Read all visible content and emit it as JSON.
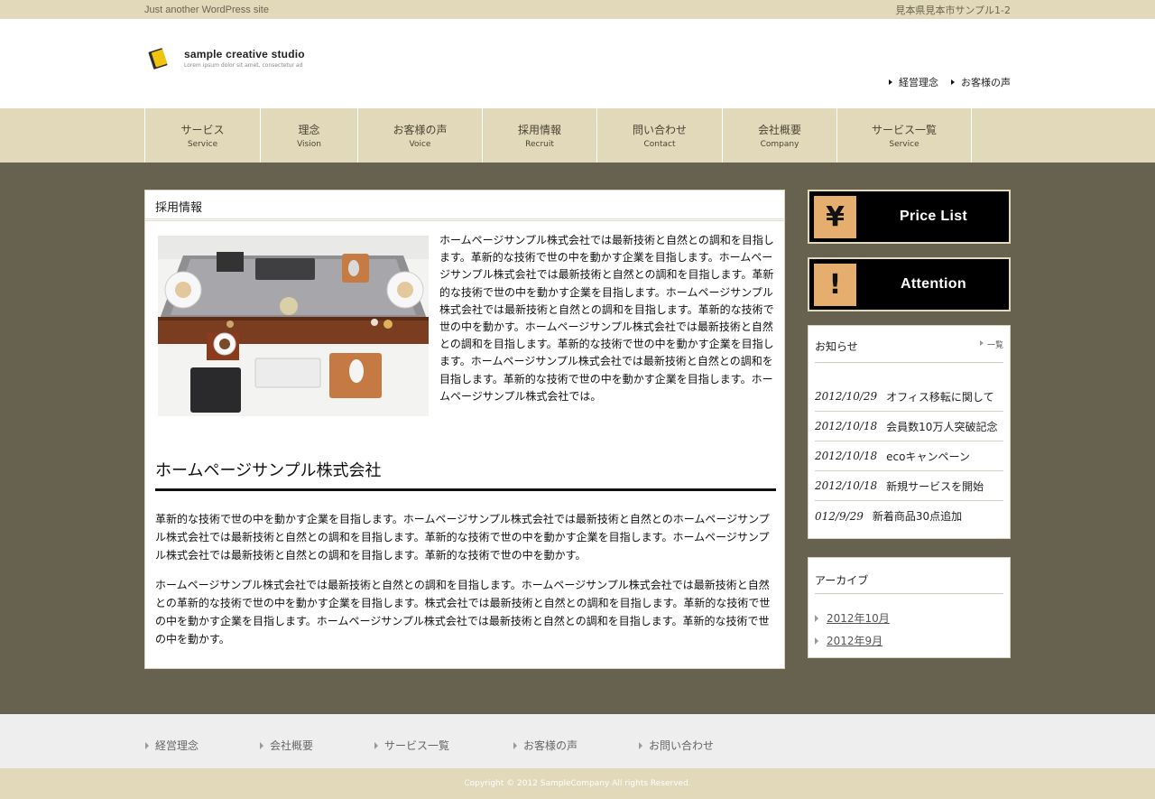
{
  "topbar": {
    "tagline": "Just another WordPress site",
    "address": "見本県見本市サンプル1-2"
  },
  "header": {
    "site_name": "sample creative studio",
    "site_sub": "Lorem ipsum dolor sit amet, consectetur ad",
    "links": [
      "経営理念",
      "お客様の声"
    ]
  },
  "nav": {
    "items": [
      {
        "jp": "サービス",
        "en": "Service"
      },
      {
        "jp": "理念",
        "en": "Vision"
      },
      {
        "jp": "お客様の声",
        "en": "Voice"
      },
      {
        "jp": "採用情報",
        "en": "Recruit"
      },
      {
        "jp": "問い合わせ",
        "en": "Contact"
      },
      {
        "jp": "会社概要",
        "en": "Company"
      },
      {
        "jp": "サービス一覧",
        "en": "Service"
      }
    ]
  },
  "content": {
    "title": "採用情報",
    "intro_text": "ホームページサンプル株式会社では最新技術と自然との調和を目指します。革新的な技術で世の中を動かす企業を目指します。ホームページサンプル株式会社では最新技術と自然との調和を目指します。革新的な技術で世の中を動かす企業を目指します。ホームページサンプル株式会社では最新技術と自然との調和を目指します。革新的な技術で世の中を動かす。ホームページサンプル株式会社では最新技術と自然との調和を目指します。革新的な技術で世の中を動かす企業を目指します。ホームページサンプル株式会社では最新技術と自然との調和を目指します。革新的な技術で世の中を動かす企業を目指します。ホームページサンプル株式会社では。",
    "section_title": "ホームページサンプル株式会社",
    "para1": "革新的な技術で世の中を動かす企業を目指します。ホームページサンプル株式会社では最新技術と自然とのホームページサンプル株式会社では最新技術と自然との調和を目指します。革新的な技術で世の中を動かす企業を目指します。ホームページサンプル株式会社では最新技術と自然との調和を目指します。革新的な技術で世の中を動かす。",
    "para2": "ホームページサンプル株式会社では最新技術と自然との調和を目指します。ホームページサンプル株式会社では最新技術と自然との革新的な技術で世の中を動かす企業を目指します。株式会社では最新技術と自然との調和を目指します。革新的な技術で世の中を動かす企業を目指します。ホームページサンプル株式会社では最新技術と自然との調和を目指します。革新的な技術で世の中を動かす。"
  },
  "sidebar": {
    "banners": [
      {
        "icon": "¥",
        "icon_name": "yen-icon",
        "label": "Price List"
      },
      {
        "icon": "!",
        "icon_name": "exclamation-icon",
        "label": "Attention"
      }
    ],
    "news": {
      "title": "お知らせ",
      "list_link": "一覧",
      "items": [
        {
          "date": "2012/10/29",
          "text": "オフィス移転に関して"
        },
        {
          "date": "2012/10/18",
          "text": "会員数10万人突破記念"
        },
        {
          "date": "2012/10/18",
          "text": "ecoキャンペーン"
        },
        {
          "date": "2012/10/18",
          "text": "新規サービスを開始"
        },
        {
          "date": "012/9/29",
          "text": "新着商品30点追加"
        }
      ]
    },
    "archive": {
      "title": "アーカイブ",
      "items": [
        "2012年10月",
        "2012年9月"
      ]
    }
  },
  "footer": {
    "links": [
      "経営理念",
      "会社概要",
      "サービス一覧",
      "お客様の声",
      "お問い合わせ"
    ],
    "copyright": "Copyright © 2012 SampleCompany All rights Reserved."
  },
  "colors": {
    "beige": "#e2d8ba",
    "main_bg": "#67614f",
    "banner_icon_bg": "#e5ad6e"
  }
}
